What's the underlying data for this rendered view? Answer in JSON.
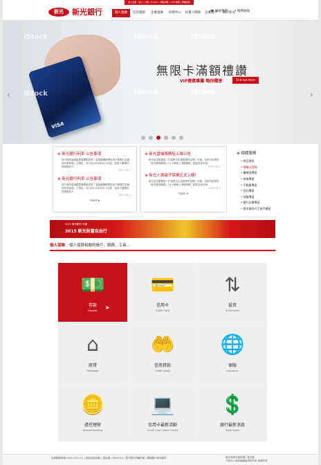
{
  "header": {
    "top_links": "加入最愛｜電子 | 行動 | English | 網站導覽 | ATM 地圖 | 營業據點",
    "logo_mark": "新光",
    "logo_text": "新光銀行",
    "nav": [
      "個人金融",
      "信託理財",
      "企業金融",
      "財務中心",
      "投資人關係",
      "企業簡介",
      "關於新光"
    ],
    "util": [
      "聯絡我們",
      "服務據點"
    ]
  },
  "hero": {
    "watermark": "iStock",
    "title": "無限卡滿額禮讚",
    "subtitle": "VIP貴賓專屬 略你獨享",
    "button": "Find out more",
    "card_brand": "VISA",
    "slides": 6,
    "active_slide": 3
  },
  "news": {
    "left": [
      {
        "title": "新光銀行利率 公告事項",
        "body": "依行政院金融監督管理委員會「金融機構辦理信用卡業務訂定最低利率事項」之規定，本行自105年6月14日起，信用卡循環利率調整如下。",
        "date": "2017.01.1"
      },
      {
        "title": "新光銀行利率 公告事項",
        "body": "依行政院金融監督管理委員會「金融機構辦理信用卡業務訂定最低利率事項」之規定，本行自105年6月14日起，信用卡循環利率調整如下。",
        "date": "2017.01.1"
      }
    ],
    "right": [
      {
        "title": "新光雲端服務給上線公告",
        "body": "新光金控集團為「打造數位化金融環境目標」計畫，自即日起提供「新光雲端服務」24小時線上申辦服務，歡迎多加利用。",
        "date": "2017.01.1"
      },
      {
        "title": "新光人壽電子保單正式上線！",
        "body": "新光金控集團為「打造數位化金融環境目標」計畫，自即日起提供「新光雲端服務」24小時線上申辦服務，歡迎多加利用。",
        "date": "2017.01.1"
      }
    ],
    "more": "more"
  },
  "related": {
    "title": "相關服務",
    "items": [
      "商品資訊",
      "保險小百科",
      "醫療保專區",
      "房貸專區",
      "不動產專區",
      "信託專區",
      "保險專區",
      "銀行計算專區",
      "基本資料行工具手續區"
    ]
  },
  "banner": {
    "year": "2015 新光銀行 年度",
    "title": "2015 新光財富自由行"
  },
  "section": {
    "label": "個人保險",
    "desc": "個人保險相關的帳戶、服務、工具..."
  },
  "tiles": [
    {
      "cn": "存款",
      "en": "Deposit",
      "icon": "deposit-icon"
    },
    {
      "cn": "信用卡",
      "en": "Credit Card",
      "icon": "credit-card-icon"
    },
    {
      "cn": "投資",
      "en": "Investment",
      "icon": "investment-icon"
    },
    {
      "cn": "房貸",
      "en": "Mortgage",
      "icon": "mortgage-icon"
    },
    {
      "cn": "信用貸款",
      "en": "Credit Loans",
      "icon": "credit-loan-icon"
    },
    {
      "cn": "保險",
      "en": "Insurance",
      "icon": "insurance-icon"
    },
    {
      "cn": "遠控理財",
      "en": "Remote Banking",
      "icon": "remote-banking-icon"
    },
    {
      "cn": "信用卡最新活動",
      "en": "Credit Card Latest Events",
      "icon": "card-events-icon"
    },
    {
      "cn": "銀行最新消息",
      "en": "Bank News",
      "icon": "bank-news-icon"
    }
  ],
  "footer": {
    "left": "免費服務專線 0800-001-111 | 網站使用條款 | 隱私權 | ENGLISH | 電子郵件詐騙防範 | 網路銀行使用條件",
    "right_1": "版本為新光美術第一頁此區",
    "right_2": "©新光人壽財務顧客資料所有 版權所有"
  }
}
